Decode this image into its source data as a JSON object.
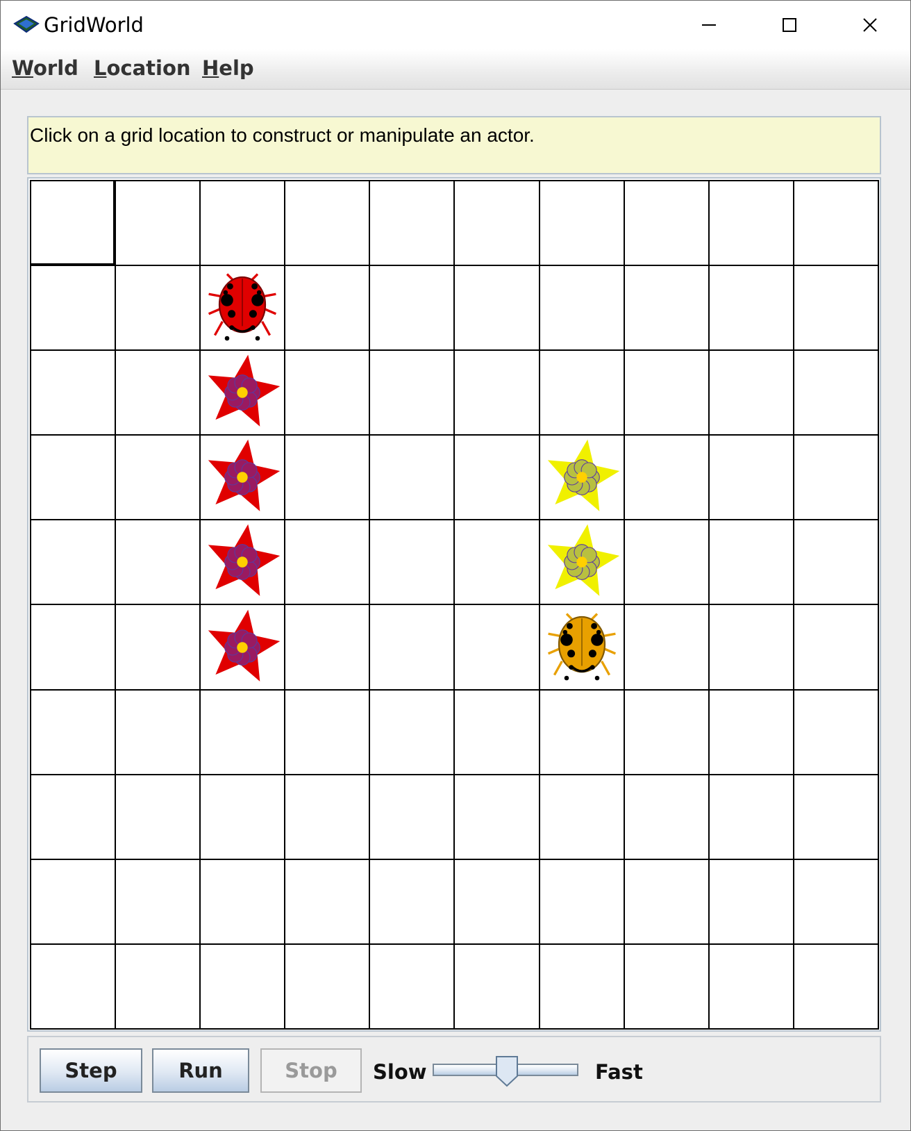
{
  "window": {
    "title": "GridWorld",
    "icon": "gridworld-app-icon",
    "controls": [
      "minimize-icon",
      "maximize-icon",
      "close-icon"
    ]
  },
  "menu": {
    "world": {
      "mnemonic": "W",
      "rest": "orld"
    },
    "location": {
      "mnemonic": "L",
      "rest": "ocation"
    },
    "help": {
      "mnemonic": "H",
      "rest": "elp"
    }
  },
  "message": "Click on a grid location to construct or manipulate an actor.",
  "grid": {
    "rows": 10,
    "cols": 10,
    "selected": {
      "row": 0,
      "col": 0
    },
    "actors": [
      {
        "row": 1,
        "col": 2,
        "type": "bug",
        "color": "#e00000",
        "icon": "bug-icon"
      },
      {
        "row": 2,
        "col": 2,
        "type": "flower",
        "color": "#e00000",
        "icon": "flower-icon"
      },
      {
        "row": 3,
        "col": 2,
        "type": "flower",
        "color": "#e00000",
        "icon": "flower-icon"
      },
      {
        "row": 4,
        "col": 2,
        "type": "flower",
        "color": "#e00000",
        "icon": "flower-icon"
      },
      {
        "row": 5,
        "col": 2,
        "type": "flower",
        "color": "#e00000",
        "icon": "flower-icon"
      },
      {
        "row": 3,
        "col": 6,
        "type": "flower",
        "color": "#f0f000",
        "icon": "flower-icon"
      },
      {
        "row": 4,
        "col": 6,
        "type": "flower",
        "color": "#f0f000",
        "icon": "flower-icon"
      },
      {
        "row": 5,
        "col": 6,
        "type": "bug",
        "color": "#e8a000",
        "icon": "bug-icon"
      }
    ]
  },
  "controls": {
    "step": "Step",
    "run": "Run",
    "stop": "Stop",
    "stop_enabled": false,
    "slow": "Slow",
    "fast": "Fast",
    "speed_fraction": 0.5
  }
}
